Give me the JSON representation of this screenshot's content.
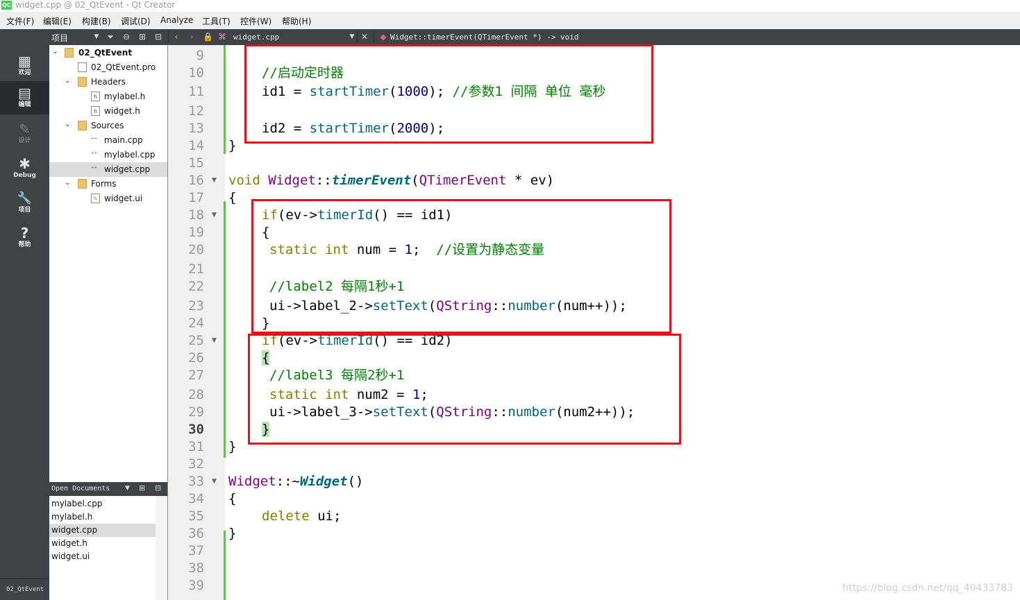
{
  "window": {
    "title": "widget.cpp @ 02_QtEvent - Qt Creator",
    "logo": "QC"
  },
  "menu": [
    "文件(F)",
    "编辑(E)",
    "构建(B)",
    "调试(D)",
    "Analyze",
    "工具(T)",
    "控件(W)",
    "帮助(H)"
  ],
  "toolbar": {
    "panel_label": "项目",
    "filename": "widget.cpp",
    "symbol": "Widget::timerEvent(QTimerEvent *) -> void"
  },
  "modes": [
    {
      "label": "欢迎",
      "icon": "grid-icon",
      "glyph": "▦"
    },
    {
      "label": "编辑",
      "icon": "document-icon",
      "glyph": "▤"
    },
    {
      "label": "设计",
      "icon": "pencil-icon",
      "glyph": "✎"
    },
    {
      "label": "Debug",
      "icon": "bug-icon",
      "glyph": "✱"
    },
    {
      "label": "项目",
      "icon": "wrench-icon",
      "glyph": "🔧"
    },
    {
      "label": "帮助",
      "icon": "help-icon",
      "glyph": "?"
    }
  ],
  "mode_project": "02_QtEvent",
  "tree": [
    {
      "label": "02_QtEvent",
      "arrow": "⌄",
      "kind": "project"
    },
    {
      "label": "02_QtEvent.pro",
      "arrow": "",
      "kind": "file"
    },
    {
      "label": "Headers",
      "arrow": "⌄",
      "kind": "folder"
    },
    {
      "label": "mylabel.h",
      "arrow": "",
      "kind": "header"
    },
    {
      "label": "widget.h",
      "arrow": "",
      "kind": "header"
    },
    {
      "label": "Sources",
      "arrow": "⌄",
      "kind": "folder"
    },
    {
      "label": "main.cpp",
      "arrow": "",
      "kind": "source"
    },
    {
      "label": "mylabel.cpp",
      "arrow": "",
      "kind": "source"
    },
    {
      "label": "widget.cpp",
      "arrow": "",
      "kind": "source",
      "selected": true
    },
    {
      "label": "Forms",
      "arrow": "⌄",
      "kind": "folder"
    },
    {
      "label": "widget.ui",
      "arrow": "",
      "kind": "form"
    }
  ],
  "open_documents": {
    "title": "Open Documents",
    "items": [
      "mylabel.cpp",
      "mylabel.h",
      "widget.cpp",
      "widget.h",
      "widget.ui"
    ],
    "selected": "widget.cpp"
  },
  "line_numbers": [
    "9",
    "10",
    "11",
    "12",
    "13",
    "14",
    "15",
    "16",
    "17",
    "18",
    "19",
    "20",
    "21",
    "22",
    "23",
    "24",
    "25",
    "26",
    "27",
    "28",
    "29",
    "30",
    "31",
    "32",
    "33",
    "34",
    "35",
    "36",
    "37",
    "38",
    "39"
  ],
  "current_line": "30",
  "fold_markers": [
    "16",
    "18",
    "25",
    "33"
  ],
  "code": {
    "l10": "//启动定时器",
    "l11_a": "id1 = ",
    "l11_b": "startTimer",
    "l11_c": "(",
    "l11_d": "1000",
    "l11_e": "); ",
    "l11_f": "//参数1 间隔 单位 毫秒",
    "l13_a": "id2 = ",
    "l13_b": "startTimer",
    "l13_c": "(",
    "l13_d": "2000",
    "l13_e": ");",
    "l14": "}",
    "l16_a": "void",
    "l16_b": "Widget",
    "l16_c": "::",
    "l16_d": "timerEvent",
    "l16_e": "(",
    "l16_f": "QTimerEvent",
    "l16_g": " * ev)",
    "l17": "{",
    "l18_a": "if",
    "l18_b": "(ev->",
    "l18_c": "timerId",
    "l18_d": "() == id1)",
    "l19": "{",
    "l20_a": "static",
    "l20_b": "int",
    "l20_c": " num = ",
    "l20_d": "1",
    "l20_e": ";  ",
    "l20_f": "//设置为静态变量",
    "l22": "//label2 每隔1秒+1",
    "l23_a": "ui->label_2->",
    "l23_b": "setText",
    "l23_c": "(",
    "l23_d": "QString",
    "l23_e": "::",
    "l23_f": "number",
    "l23_g": "(num++));",
    "l24": "}",
    "l25_a": "if",
    "l25_b": "(ev->",
    "l25_c": "timerId",
    "l25_d": "() == id2)",
    "l26": "{",
    "l27": "//label3 每隔2秒+1",
    "l28_a": "static",
    "l28_b": "int",
    "l28_c": " num2 = ",
    "l28_d": "1",
    "l28_e": ";",
    "l29_a": "ui->label_3->",
    "l29_b": "setText",
    "l29_c": "(",
    "l29_d": "QString",
    "l29_e": "::",
    "l29_f": "number",
    "l29_g": "(num2++));",
    "l30": "}",
    "l31": "}",
    "l33_a": "Widget",
    "l33_b": "::~",
    "l33_c": "Widget",
    "l33_d": "()",
    "l34": "{",
    "l35_a": "delete",
    "l35_b": " ui;",
    "l36": "}"
  },
  "watermark": "https://blog.csdn.net/qq_40433783",
  "colors": {
    "keyword": "#808000",
    "type": "#800080",
    "function": "#00677c",
    "number": "#000080",
    "comment": "#008000",
    "annotation": "#e0141e",
    "sidebar": "#404244"
  }
}
